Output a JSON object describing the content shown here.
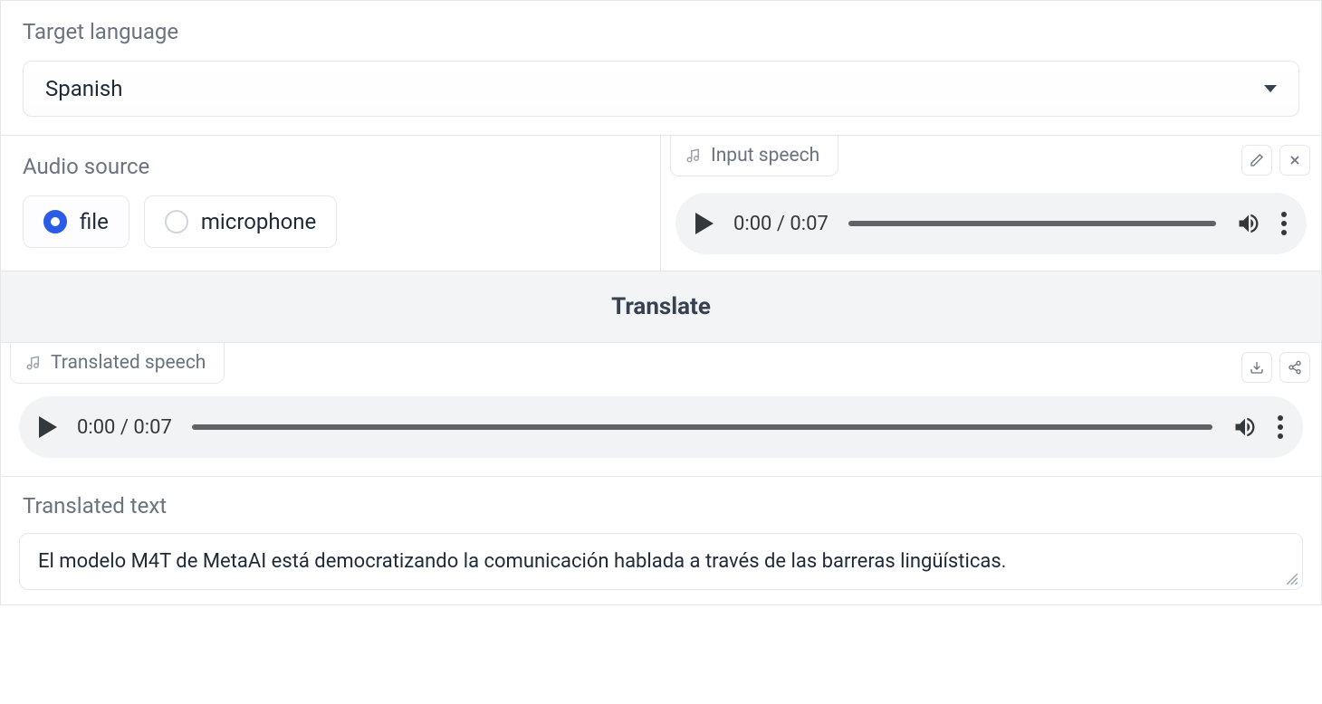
{
  "target_language": {
    "label": "Target language",
    "value": "Spanish"
  },
  "audio_source": {
    "label": "Audio source",
    "options": {
      "file": "file",
      "microphone": "microphone"
    },
    "selected": "file"
  },
  "input_speech": {
    "label": "Input speech",
    "time_current": "0:00",
    "time_total": "0:07"
  },
  "translate_button": "Translate",
  "translated_speech": {
    "label": "Translated speech",
    "time_current": "0:00",
    "time_total": "0:07"
  },
  "translated_text": {
    "label": "Translated text",
    "value": "El modelo M4T de MetaAI está democratizando la comunicación hablada a través de las barreras lingüísticas."
  }
}
